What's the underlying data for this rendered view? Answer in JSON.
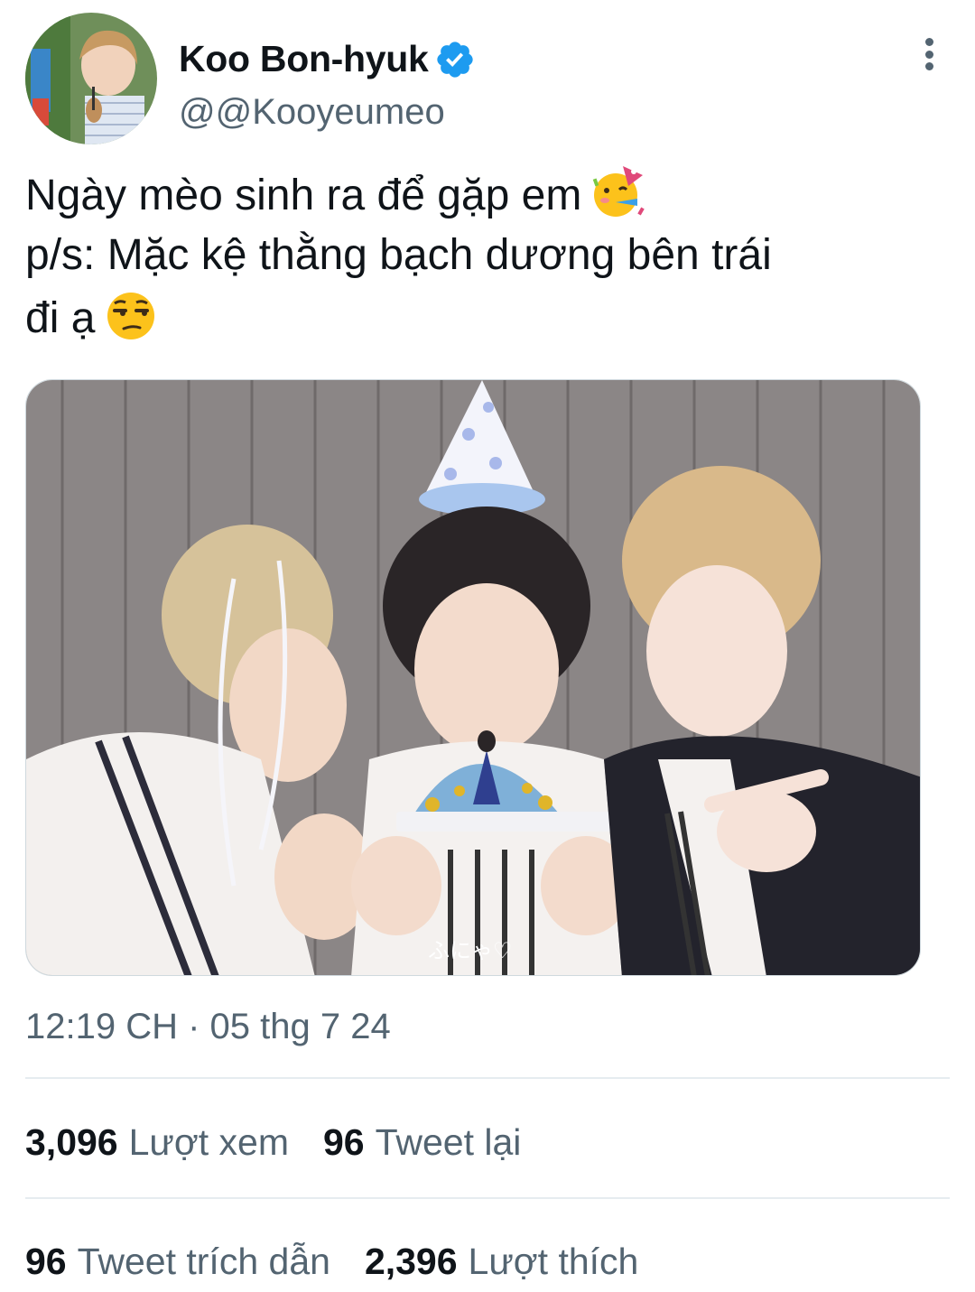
{
  "author": {
    "display_name": "Koo Bon-hyuk",
    "handle": "@@Kooyeumeo",
    "verified": true
  },
  "tweet": {
    "line1": "Ngày mèo sinh ra để gặp em",
    "line2": "p/s: Mặc kệ thằng bạch dương bên trái",
    "line3": "đi ạ",
    "line1_emoji": "partying-face",
    "line3_emoji": "unamused-face",
    "timestamp": "12:19 CH · 05 thg 7 24"
  },
  "media": {
    "signature": "ふにゃ♡"
  },
  "stats": {
    "views_count": "3,096",
    "views_label": "Lượt xem",
    "retweets_count": "96",
    "retweets_label": "Tweet lại",
    "quotes_count": "96",
    "quotes_label": "Tweet trích dẫn",
    "likes_count": "2,396",
    "likes_label": "Lượt thích"
  },
  "colors": {
    "text_primary": "#0f1419",
    "text_secondary": "#536471",
    "verified_blue": "#1d9bf0",
    "divider": "#e6ecf0"
  }
}
